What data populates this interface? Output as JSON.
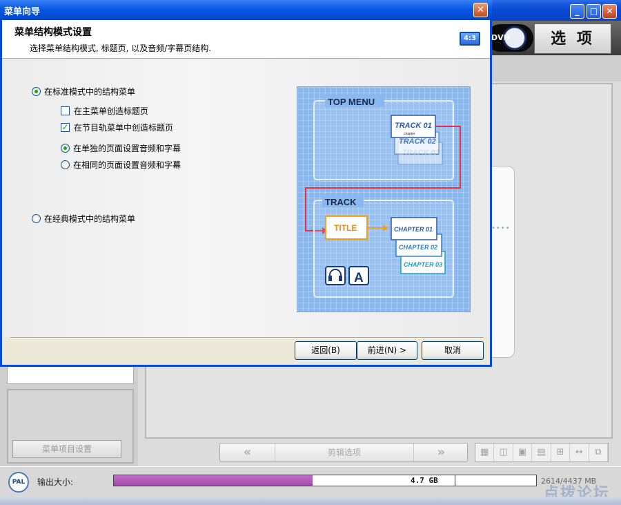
{
  "app": {
    "dvd_label": "DVD",
    "options_label": "选 项",
    "menu_item_settings": "菜单项目设置",
    "edit_options": "剪辑选项",
    "edit_prev": "«",
    "edit_next": "»",
    "layout_icons": [
      "grid-icon",
      "split-icon",
      "fit-icon",
      "safe-area-icon",
      "cross-icon",
      "stretch-icon",
      "window-icon"
    ],
    "layout_glyphs": [
      "▦",
      "◫",
      "▣",
      "▤",
      "⊞",
      "↔",
      "⧉"
    ],
    "status": {
      "pal": "PAL",
      "output_size_label": "输出大小:",
      "disc_capacity": "4.7 GB",
      "size_text": "2614/4437 MB",
      "used_fraction": 0.47
    },
    "watermark": "点拨论坛"
  },
  "dialog": {
    "title": "菜单向导",
    "close": "✕",
    "heading": "菜单结构模式设置",
    "subtitle": "选择菜单结构模式, 标题页, 以及音频/字幕页结构.",
    "aspect_badge": "4:3",
    "options": {
      "standard_mode": "在标准模式中的结构菜单",
      "create_title_main": "在主菜单创造标题页",
      "create_title_track": "在节目轨菜单中创造标题页",
      "separate_page": "在单独的页面设置音频和字幕",
      "same_page": "在相同的页面设置音频和字幕",
      "classic_mode": "在经典模式中的结构菜单"
    },
    "state": {
      "standard_mode": true,
      "create_title_main": false,
      "create_title_track": true,
      "separate_page": true,
      "same_page": false,
      "classic_mode": false
    },
    "buttons": {
      "back": "返回(B)",
      "next": "前进(N) >",
      "cancel": "取消"
    },
    "illustration": {
      "top_menu": "TOP MENU",
      "track_label": "TRACK",
      "tracks": [
        "TRACK 01",
        "TRACK 02",
        "TRACK 03"
      ],
      "track_caption": "chapter",
      "title": "TITLE",
      "chapters": [
        "CHAPTER 01",
        "CHAPTER 02",
        "CHAPTER 03"
      ],
      "audio_icon": "headphones-icon",
      "subtitle_icon": "subtitle-icon",
      "subtitle_glyph": "A"
    }
  }
}
